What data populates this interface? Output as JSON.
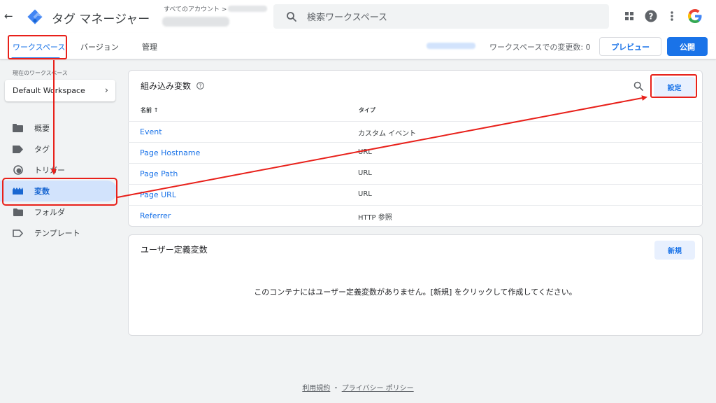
{
  "header": {
    "back_icon": "back-arrow-icon",
    "logo_icon": "tag-manager-logo-icon",
    "app_title": "タグ マネージャー",
    "account_crumb": "すべてのアカウント >",
    "search_placeholder": "検索ワークスペース",
    "search_icon": "search-icon",
    "apps_icon": "apps-grid-icon",
    "help_icon": "help-icon",
    "more_icon": "more-vert-icon",
    "google_icon": "google-g-icon"
  },
  "subnav": {
    "tabs": [
      {
        "label": "ワークスペース",
        "active": true
      },
      {
        "label": "バージョン",
        "active": false
      },
      {
        "label": "管理",
        "active": false
      }
    ],
    "changes_text": "ワークスペースでの変更数: 0",
    "preview_label": "プレビュー",
    "publish_label": "公開"
  },
  "sidebar": {
    "current_ws_label": "現在のワークスペース",
    "workspace_name": "Default Workspace",
    "items": [
      {
        "label": "概要",
        "icon": "overview-folder-icon",
        "active": false
      },
      {
        "label": "タグ",
        "icon": "tag-icon",
        "active": false
      },
      {
        "label": "トリガー",
        "icon": "trigger-icon",
        "active": false
      },
      {
        "label": "変数",
        "icon": "variables-icon",
        "active": true
      },
      {
        "label": "フォルダ",
        "icon": "folder-icon",
        "active": false
      },
      {
        "label": "テンプレート",
        "icon": "template-icon",
        "active": false
      }
    ]
  },
  "builtin": {
    "title": "組み込み変数",
    "help_icon": "help-circle-icon",
    "search_icon": "search-icon",
    "config_label": "設定",
    "col_name": "名前 ↑",
    "col_type": "タイプ",
    "rows": [
      {
        "name": "Event",
        "type": "カスタム イベント"
      },
      {
        "name": "Page Hostname",
        "type": "URL"
      },
      {
        "name": "Page Path",
        "type": "URL"
      },
      {
        "name": "Page URL",
        "type": "URL"
      },
      {
        "name": "Referrer",
        "type": "HTTP 参照"
      }
    ]
  },
  "user_defined": {
    "title": "ユーザー定義変数",
    "new_label": "新規",
    "empty_message": "このコンテナにはユーザー定義変数がありません。[新規] をクリックして作成してください。"
  },
  "footer": {
    "terms": "利用規約",
    "separator": "・",
    "privacy": "プライバシー ポリシー"
  },
  "colors": {
    "accent": "#1a73e8",
    "annotation": "#e8201a"
  }
}
